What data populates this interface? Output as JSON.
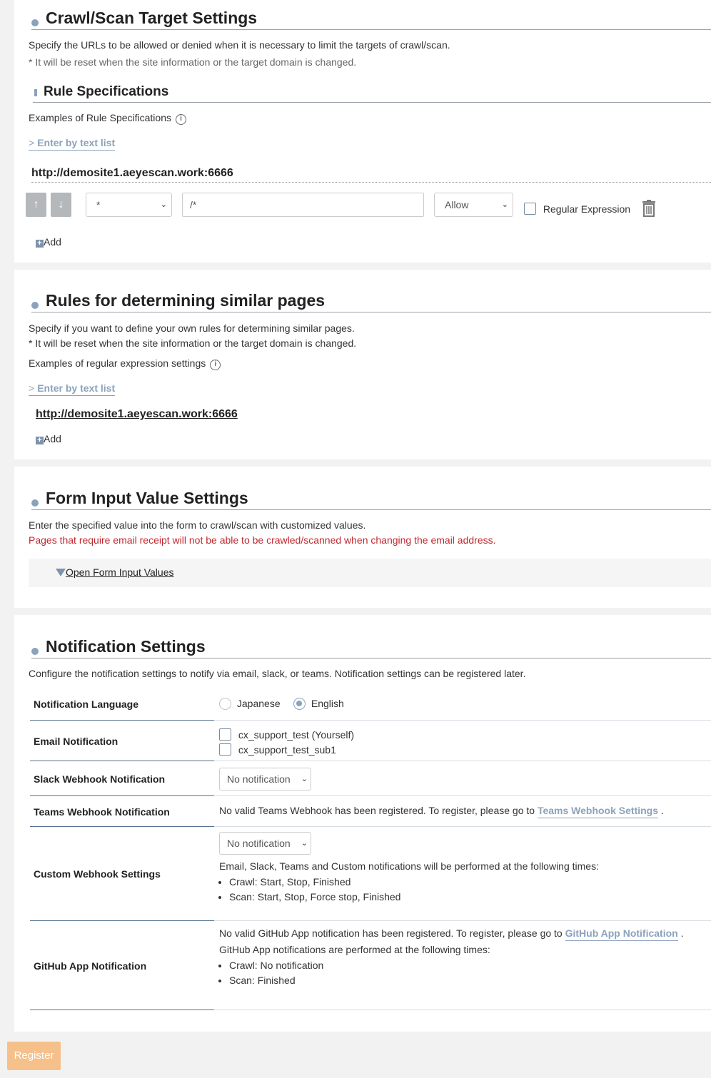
{
  "crawl": {
    "title": "Crawl/Scan Target Settings",
    "desc": "Specify the URLs to be allowed or denied when it is necessary to limit the targets of crawl/scan.",
    "note": "* It will be reset when the site information or the target domain is changed.",
    "rule_title": "Rule Specifications",
    "examples": "Examples of Rule Specifications",
    "text_list": "Enter by text list",
    "site_url": "http://demosite1.aeyescan.work:6666",
    "rule": {
      "method": "*",
      "path": "/*",
      "action": "Allow",
      "regex_label": "Regular Expression"
    },
    "add": "Add"
  },
  "similar": {
    "title": "Rules for determining similar pages",
    "desc": "Specify if you want to define your own rules for determining similar pages.",
    "note": "* It will be reset when the site information or the target domain is changed.",
    "examples": "Examples of regular expression settings",
    "text_list": "Enter by text list",
    "site_url": "http://demosite1.aeyescan.work:6666",
    "add": "Add"
  },
  "form": {
    "title": "Form Input Value Settings",
    "desc": "Enter the specified value into the form to crawl/scan with customized values.",
    "warning": "Pages that require email receipt will not be able to be crawled/scanned when changing the email address.",
    "open": "Open Form Input Values"
  },
  "notify": {
    "title": "Notification Settings",
    "desc": "Configure the notification settings to notify via email, slack, or teams. Notification settings can be registered later.",
    "language_label": "Notification Language",
    "lang_ja": "Japanese",
    "lang_en": "English",
    "email_label": "Email Notification",
    "email_1": "cx_support_test (Yourself)",
    "email_2": "cx_support_test_sub1",
    "slack_label": "Slack Webhook Notification",
    "slack_value": "No notification",
    "teams_label": "Teams Webhook Notification",
    "teams_text": "No valid Teams Webhook has been registered. To register, please go to",
    "teams_link": "Teams Webhook Settings",
    "custom_label": "Custom Webhook Settings",
    "custom_value": "No notification",
    "custom_times": "Email, Slack, Teams and Custom notifications will be performed at the following times:",
    "custom_crawl": "Crawl: Start, Stop, Finished",
    "custom_scan": "Scan: Start, Stop, Force stop, Finished",
    "github_label": "GitHub App Notification",
    "github_text": "No valid GitHub App notification has been registered. To register, please go to",
    "github_link": "GitHub App Notification",
    "github_times": "GitHub App notifications are performed at the following times:",
    "github_crawl": "Crawl: No notification",
    "github_scan": "Scan: Finished"
  },
  "register": "Register",
  "colors": {
    "accent": "#8ba2bd",
    "warning": "#c0282d",
    "register_bg": "#f6c08a"
  }
}
